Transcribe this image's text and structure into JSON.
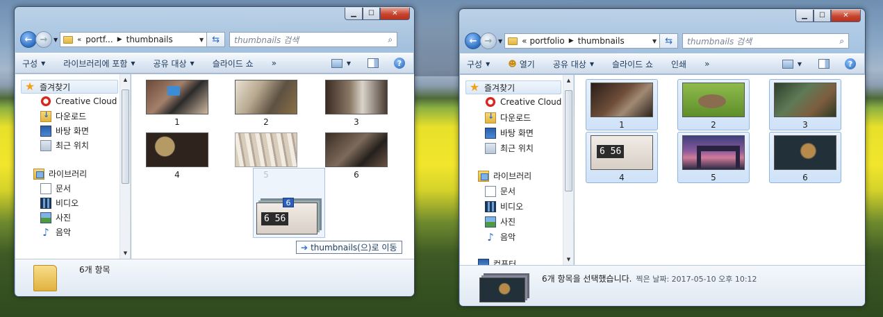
{
  "left_window": {
    "breadcrumb": [
      "portf...",
      "thumbnails"
    ],
    "search_placeholder": "thumbnails 검색",
    "toolbar": [
      "구성",
      "라이브러리에 포함",
      "공유 대상",
      "슬라이드 쇼",
      "»"
    ],
    "nav": {
      "favorites": "즐겨찾기",
      "items": [
        "Creative Cloud F",
        "다운로드",
        "바탕 화면",
        "최근 위치"
      ],
      "libraries": "라이브러리",
      "lib_items": [
        "문서",
        "비디오",
        "사진",
        "음악"
      ]
    },
    "thumbnails": [
      "1",
      "2",
      "3",
      "4",
      "5",
      "6"
    ],
    "status": "6개 항목",
    "drag_count": "6",
    "drag_tooltip": "thumbnails(으)로 이동"
  },
  "right_window": {
    "breadcrumb_prefix": "«",
    "breadcrumb": [
      "portfolio",
      "thumbnails"
    ],
    "search_placeholder": "thumbnails 검색",
    "toolbar": [
      "구성",
      "열기",
      "공유 대상",
      "슬라이드 쇼",
      "인쇄",
      "»"
    ],
    "nav": {
      "favorites": "즐겨찾기",
      "items": [
        "Creative Cloud F",
        "다운로드",
        "바탕 화면",
        "최근 위치"
      ],
      "libraries": "라이브러리",
      "lib_items": [
        "문서",
        "비디오",
        "사진",
        "음악"
      ],
      "computer": "컴퓨터"
    },
    "thumbnails": [
      "1",
      "2",
      "3",
      "4",
      "5",
      "6"
    ],
    "status": "6개 항목을 선택했습니다.",
    "status_meta": "찍은 날짜: 2017-05-10 오후 10:12"
  },
  "caption": {
    "minimize": "▁",
    "maximize": "☐",
    "close": "✕"
  },
  "icons": [
    "back-icon",
    "forward-icon",
    "folder-icon",
    "refresh-icon",
    "search-icon",
    "view-icon",
    "preview-pane-icon",
    "help-icon",
    "star-icon",
    "creative-cloud-icon",
    "download-icon",
    "desktop-icon",
    "recent-icon",
    "library-icon",
    "document-icon",
    "video-icon",
    "photo-icon",
    "music-icon",
    "computer-icon",
    "open-icon"
  ]
}
